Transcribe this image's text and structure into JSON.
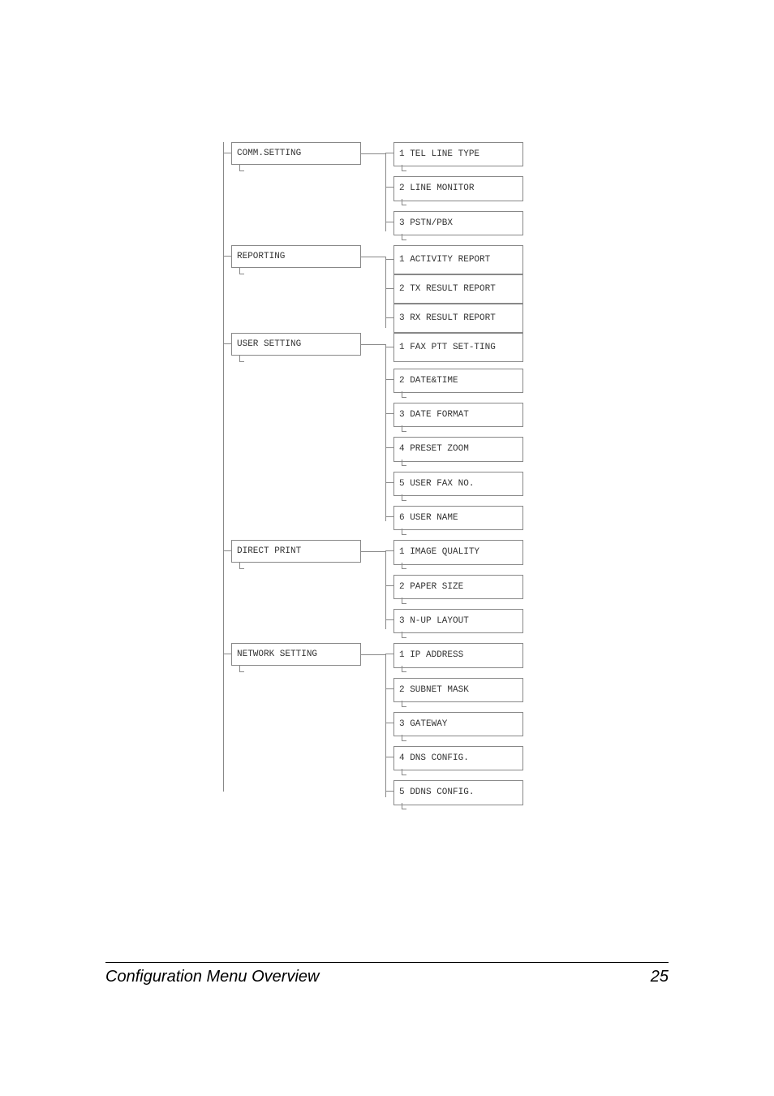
{
  "menu": [
    {
      "label": "COMM.SETTING",
      "children": [
        "1 TEL LINE TYPE",
        "2 LINE MONITOR",
        "3 PSTN/PBX"
      ]
    },
    {
      "label": "REPORTING",
      "children": [
        "1 ACTIVITY REPORT",
        "2 TX RESULT REPORT",
        "3 RX RESULT REPORT"
      ]
    },
    {
      "label": "USER SETTING",
      "children": [
        "1 FAX PTT SET-TING",
        "2 DATE&TIME",
        "3 DATE FORMAT",
        "4 PRESET ZOOM",
        "5 USER FAX NO.",
        "6 USER NAME"
      ]
    },
    {
      "label": "DIRECT PRINT",
      "children": [
        "1 IMAGE QUALITY",
        "2 PAPER SIZE",
        "3 N-UP LAYOUT"
      ]
    },
    {
      "label": "NETWORK SETTING",
      "children": [
        "1 IP ADDRESS",
        "2 SUBNET MASK",
        "3 GATEWAY",
        "4 DNS CONFIG.",
        "5 DDNS CONFIG."
      ]
    }
  ],
  "footer": {
    "title": "Configuration Menu Overview",
    "page": "25"
  }
}
